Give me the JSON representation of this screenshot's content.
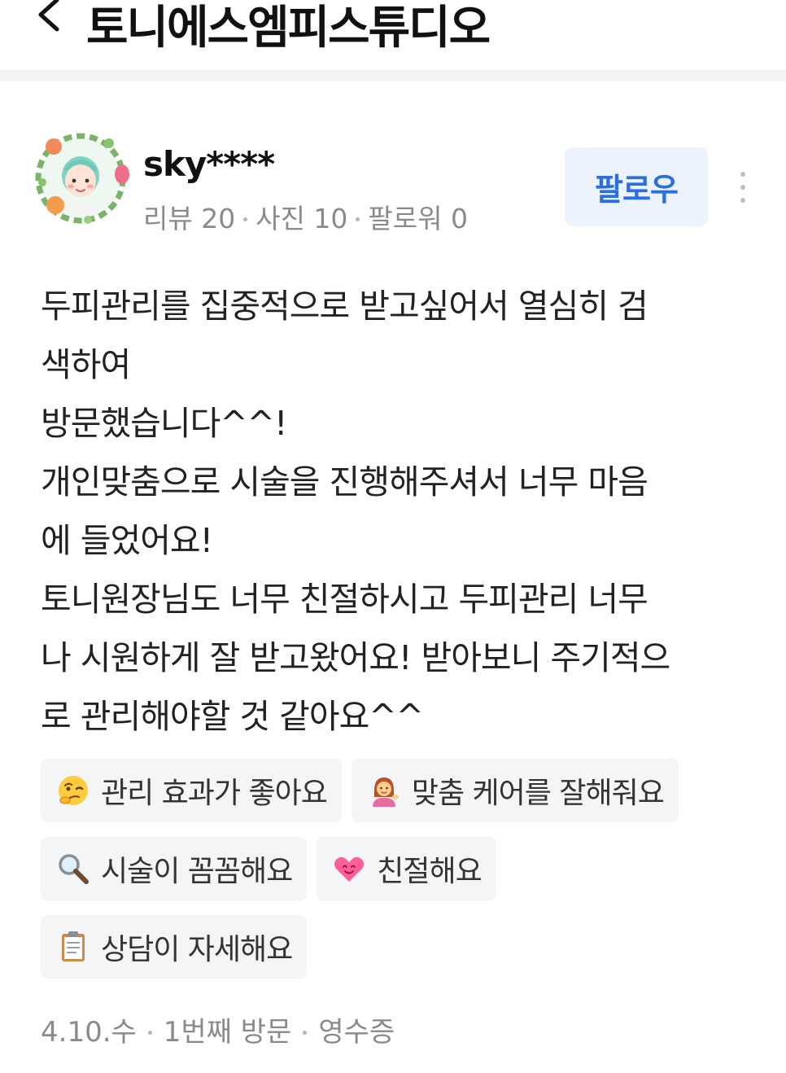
{
  "header": {
    "title": "토니에스엠피스튜디오"
  },
  "user": {
    "name": "sky****",
    "stats": [
      "리뷰 20",
      "사진 10",
      "팔로워 0"
    ],
    "follow_label": "팔로우"
  },
  "review": {
    "lines": [
      "두피관리를 집중적으로 받고싶어서 열심히 검",
      "색하여",
      "방문했습니다^^!",
      "개인맞춤으로 시술을 진행해주셔서 너무 마음",
      "에 들었어요!",
      "토니원장님도 너무 친절하시고 두피관리 너무",
      "나 시원하게 잘 받고왔어요! 받아보니 주기적으",
      "로 관리해야할 것 같아요^^"
    ]
  },
  "tags": [
    {
      "icon": "thinking-face-icon",
      "label": "관리 효과가 좋아요"
    },
    {
      "icon": "woman-tipping-hand-icon",
      "label": "맞춤 케어를 잘해줘요"
    },
    {
      "icon": "magnifying-glass-icon",
      "label": "시술이 꼼꼼해요"
    },
    {
      "icon": "heart-face-icon",
      "label": "친절해요"
    },
    {
      "icon": "clipboard-icon",
      "label": "상담이 자세해요"
    }
  ],
  "footer": {
    "date": "4.10.수",
    "visit": "1번째 방문",
    "receipt": "영수증"
  },
  "colors": {
    "accent": "#2a6ee0",
    "follow_bg": "#edf3fd",
    "tag_bg": "#f4f5f7",
    "meta_text": "#8a8a8a"
  }
}
